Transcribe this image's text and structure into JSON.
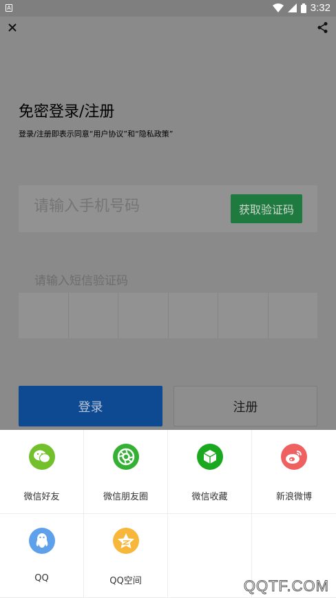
{
  "status_bar": {
    "app_icon_letter": "A",
    "time": "3:32"
  },
  "page": {
    "title": "免密登录/注册",
    "subtitle": "登录/注册即表示同意“用户协议”和“隐私政策”"
  },
  "phone": {
    "placeholder": "请输入手机号码",
    "get_code_label": "获取验证码"
  },
  "sms": {
    "label": "请输入短信验证码"
  },
  "buttons": {
    "login": "登录",
    "register": "注册"
  },
  "share": {
    "items": [
      {
        "label": "微信好友",
        "icon": "wechat-icon",
        "color": "#72c02c"
      },
      {
        "label": "微信朋友圈",
        "icon": "moments-icon",
        "color": "#34b133"
      },
      {
        "label": "微信收藏",
        "icon": "favorites-icon",
        "color": "#1aa81e"
      },
      {
        "label": "新浪微博",
        "icon": "weibo-icon",
        "color": "#ef6060"
      },
      {
        "label": "QQ",
        "icon": "qq-icon",
        "color": "#5fa0ea"
      },
      {
        "label": "QQ空间",
        "icon": "qzone-icon",
        "color": "#f6b73b"
      }
    ]
  },
  "watermark": "QQTF.COM"
}
